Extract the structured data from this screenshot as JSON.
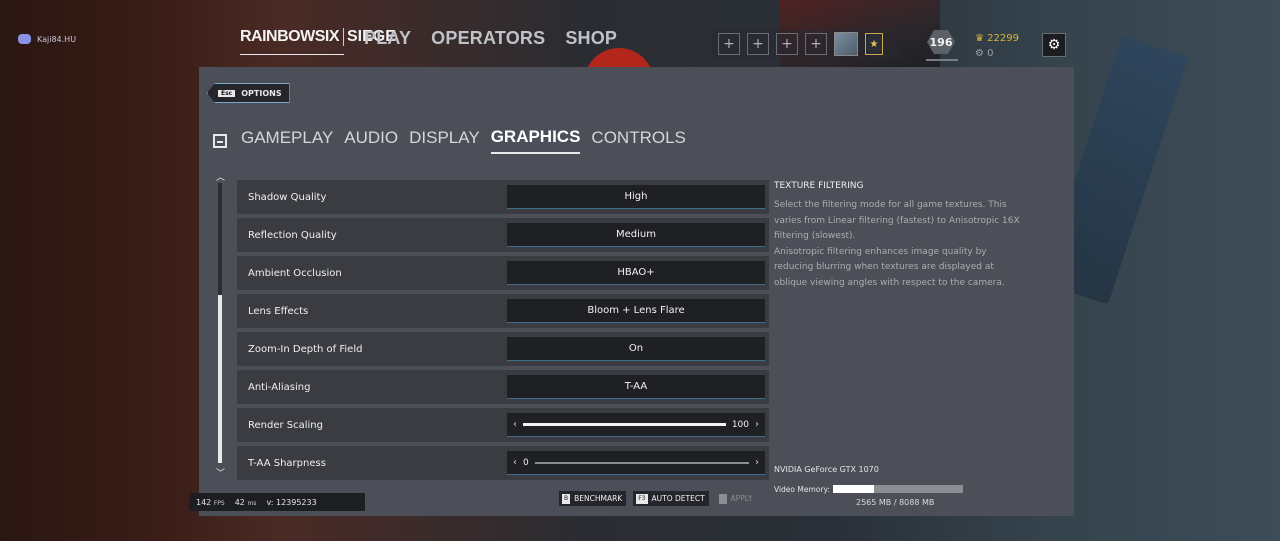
{
  "discord": {
    "username": "Kaji84.HU"
  },
  "topnav": {
    "brand_left": "RAINBOWSIX",
    "brand_right": "SIEGE",
    "links": [
      "PLAY",
      "OPERATORS",
      "SHOP"
    ]
  },
  "squad": {
    "slot_symbol": "+"
  },
  "player": {
    "level": "196",
    "renown": "22299",
    "r6credits": "0"
  },
  "options": {
    "esc_key": "Esc",
    "esc_label": "OPTIONS",
    "tabs": [
      "GAMEPLAY",
      "AUDIO",
      "DISPLAY",
      "GRAPHICS",
      "CONTROLS"
    ],
    "active_tab": "GRAPHICS"
  },
  "settings": [
    {
      "label": "Shadow Quality",
      "value": "High"
    },
    {
      "label": "Reflection Quality",
      "value": "Medium"
    },
    {
      "label": "Ambient Occlusion",
      "value": "HBAO+"
    },
    {
      "label": "Lens Effects",
      "value": "Bloom + Lens Flare"
    },
    {
      "label": "Zoom-In Depth of Field",
      "value": "On"
    },
    {
      "label": "Anti-Aliasing",
      "value": "T-AA"
    }
  ],
  "render_scaling": {
    "label": "Render Scaling",
    "value": "100",
    "fraction": 1.0
  },
  "taa_sharpness": {
    "label": "T-AA Sharpness",
    "value": "0",
    "fraction": 0.0
  },
  "description": {
    "title": "TEXTURE FILTERING",
    "body_line1": "Select the filtering mode for all game textures. This varies from Linear filtering (fastest) to Anisotropic 16X filtering (slowest).",
    "body_line2": "Anisotropic filtering enhances image quality by reducing blurring when textures are displayed at oblique viewing angles with respect to the camera."
  },
  "gpu": {
    "name": "NVIDIA GeForce GTX 1070",
    "memory_label": "Video Memory:",
    "memory_text": "2565 MB / 8088 MB",
    "memory_used_mb": 2565,
    "memory_total_mb": 8088
  },
  "actions": {
    "benchmark_key": "B",
    "benchmark_label": "BENCHMARK",
    "autodetect_key": "F3",
    "autodetect_label": "AUTO DETECT",
    "apply_label": "APPLY"
  },
  "perf": {
    "fps": "142",
    "fps_unit": "FPS",
    "ping": "42",
    "ping_unit": "ms",
    "version": "v: 12395233"
  }
}
